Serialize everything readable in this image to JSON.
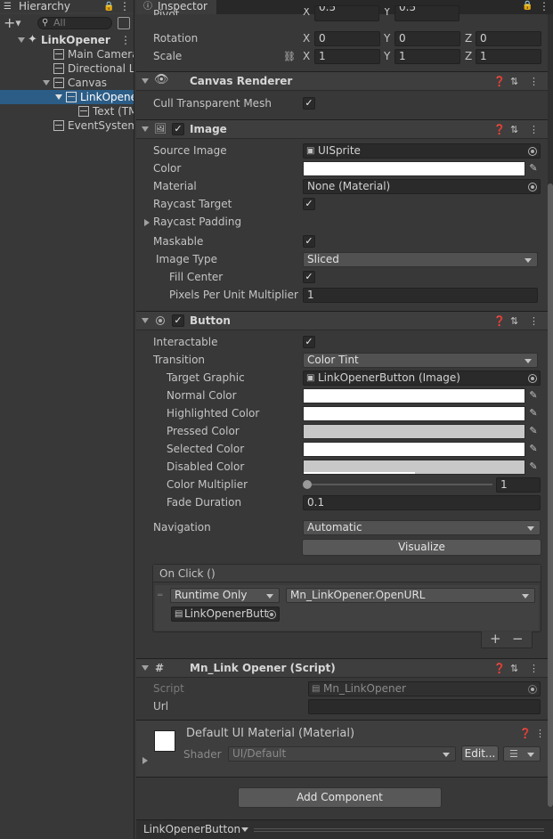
{
  "hierarchy": {
    "tab": "Hierarchy",
    "search_placeholder": "All",
    "items": [
      {
        "label": "LinkOpener"
      },
      {
        "label": "Main Camera"
      },
      {
        "label": "Directional Light"
      },
      {
        "label": "Canvas"
      },
      {
        "label": "LinkOpenerButton"
      },
      {
        "label": "Text (TMP)"
      },
      {
        "label": "EventSystem"
      }
    ]
  },
  "inspector": {
    "tab": "Inspector",
    "transform": {
      "pivot": "Pivot",
      "pivot_x": "0.5",
      "pivot_y": "0.5",
      "rotation": "Rotation",
      "rot": [
        "0",
        "0",
        "0"
      ],
      "scale": "Scale",
      "scl": [
        "1",
        "1",
        "1"
      ],
      "x": "X",
      "y": "Y",
      "z": "Z"
    },
    "canvas_renderer": {
      "title": "Canvas Renderer",
      "cull": "Cull Transparent Mesh"
    },
    "image": {
      "title": "Image",
      "source_image": "Source Image",
      "source_value": "UISprite",
      "color": "Color",
      "material": "Material",
      "material_value": "None (Material)",
      "raycast_target": "Raycast Target",
      "raycast_padding": "Raycast Padding",
      "maskable": "Maskable",
      "image_type": "Image Type",
      "image_type_value": "Sliced",
      "fill_center": "Fill Center",
      "ppu": "Pixels Per Unit Multiplier",
      "ppu_value": "1"
    },
    "button": {
      "title": "Button",
      "interactable": "Interactable",
      "transition": "Transition",
      "transition_value": "Color Tint",
      "target_graphic": "Target Graphic",
      "target_graphic_value": "LinkOpenerButton (Image)",
      "normal": "Normal Color",
      "highlighted": "Highlighted Color",
      "pressed": "Pressed Color",
      "selected": "Selected Color",
      "disabled": "Disabled Color",
      "multiplier": "Color Multiplier",
      "multiplier_value": "1",
      "fade": "Fade Duration",
      "fade_value": "0.1",
      "navigation": "Navigation",
      "navigation_value": "Automatic",
      "visualize": "Visualize",
      "onclick": "On Click ()",
      "runtime": "Runtime Only",
      "function": "Mn_LinkOpener.OpenURL",
      "object": "LinkOpenerButt",
      "plus": "+",
      "minus": "−"
    },
    "script": {
      "title": "Mn_Link Opener (Script)",
      "script_label": "Script",
      "script_value": "Mn_LinkOpener",
      "url": "Url",
      "url_value": ""
    },
    "material": {
      "title": "Default UI Material (Material)",
      "shader": "Shader",
      "shader_value": "UI/Default",
      "edit": "Edit..."
    },
    "add_component": "Add Component",
    "footer": "LinkOpenerButton"
  },
  "colors": {
    "panel": "#383838",
    "header": "#3e3e3e",
    "field": "#2a2a2a",
    "selection": "#2c5d87",
    "pressed": "#c8c8c8",
    "disabled": "#c8c8c8"
  }
}
